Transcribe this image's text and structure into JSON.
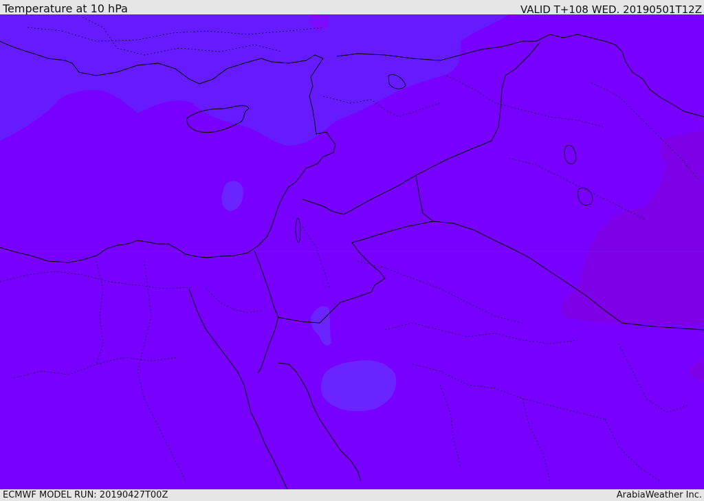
{
  "header": {
    "title": "Temperature at 10 hPa",
    "valid": "VALID T+108 WED. 20190501T12Z"
  },
  "footer": {
    "model_run": "ECMWF MODEL RUN: 20190427T00Z",
    "credit": "ArabiaWeather Inc."
  },
  "colors": {
    "base_field": "#7800ff",
    "cold_region": "#661bff",
    "warm_region": "#7f00e0",
    "coastline": "#000000",
    "background": "#e6e6e6"
  }
}
